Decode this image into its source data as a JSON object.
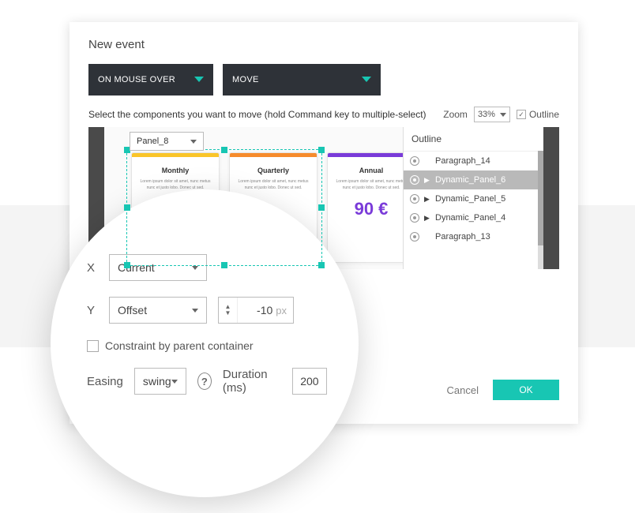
{
  "dialog": {
    "title": "New event",
    "trigger_label": "ON MOUSE OVER",
    "action_label": "MOVE",
    "instruction": "Select the components you want to move (hold Command key to multiple-select)",
    "zoom_label": "Zoom",
    "zoom_value": "33%",
    "outline_toggle_label": "Outline",
    "panel_picker": "Panel_8",
    "cancel_label": "Cancel",
    "ok_label": "OK"
  },
  "cards": [
    {
      "title": "Monthly",
      "body": "Lorem ipsum dolor sit amet, nunc metus nunc et justo lobo. Donec ut sed."
    },
    {
      "title": "Quarterly",
      "body": "Lorem ipsum dolor sit amet, nunc metus nunc et justo lobo. Donec ut sed."
    },
    {
      "title": "Annual",
      "body": "Lorem ipsum dolor sit amet, nunc metus nunc et justo lobo. Donec ut sed.",
      "price": "90 €"
    }
  ],
  "outline": {
    "heading": "Outline",
    "items": [
      {
        "label": "Paragraph_14",
        "expandable": false,
        "selected": false
      },
      {
        "label": "Dynamic_Panel_6",
        "expandable": true,
        "selected": true
      },
      {
        "label": "Dynamic_Panel_5",
        "expandable": true,
        "selected": false
      },
      {
        "label": "Dynamic_Panel_4",
        "expandable": true,
        "selected": false
      },
      {
        "label": "Paragraph_13",
        "expandable": false,
        "selected": false
      }
    ]
  },
  "move_settings": {
    "x_label": "X",
    "x_mode": "Current",
    "y_label": "Y",
    "y_mode": "Offset",
    "y_value": "-10",
    "y_unit": "px",
    "constraint_label": "Constraint by parent container",
    "easing_label": "Easing",
    "easing_value": "swing",
    "duration_label": "Duration (ms)",
    "duration_value": "200"
  }
}
